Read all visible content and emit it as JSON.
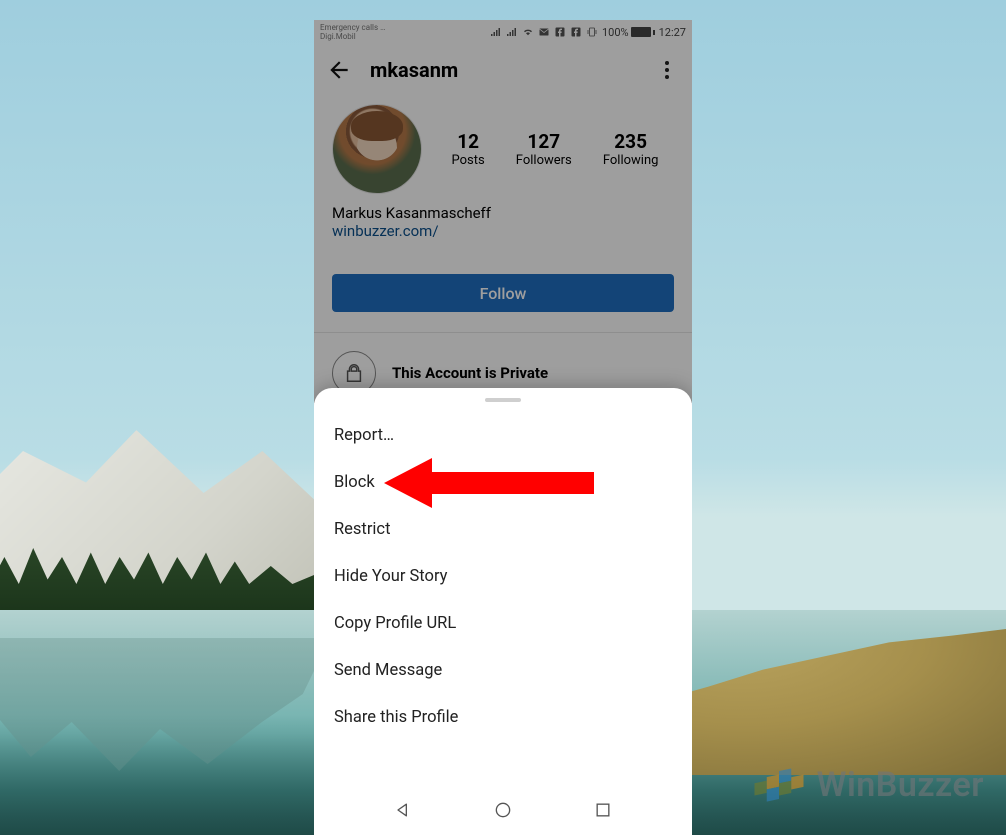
{
  "statusbar": {
    "carrier_line1": "Emergency calls …",
    "carrier_line2": "Digi.Mobil",
    "battery_pct": "100%",
    "time": "12:27"
  },
  "header": {
    "username": "mkasanm"
  },
  "profile": {
    "posts_value": "12",
    "posts_label": "Posts",
    "followers_value": "127",
    "followers_label": "Followers",
    "following_value": "235",
    "following_label": "Following",
    "display_name": "Markus Kasanmascheff",
    "website": "winbuzzer.com/",
    "follow_label": "Follow",
    "private_label": "This Account is Private"
  },
  "sheet": {
    "items": [
      "Report…",
      "Block",
      "Restrict",
      "Hide Your Story",
      "Copy Profile URL",
      "Send Message",
      "Share this Profile"
    ]
  },
  "watermark": {
    "text": "WinBuzzer"
  },
  "icons": {
    "back": "back-arrow-icon",
    "more": "more-vertical-icon",
    "lock": "lock-icon",
    "nav_back": "triangle-back-icon",
    "nav_home": "circle-home-icon",
    "nav_recent": "square-recent-icon"
  }
}
